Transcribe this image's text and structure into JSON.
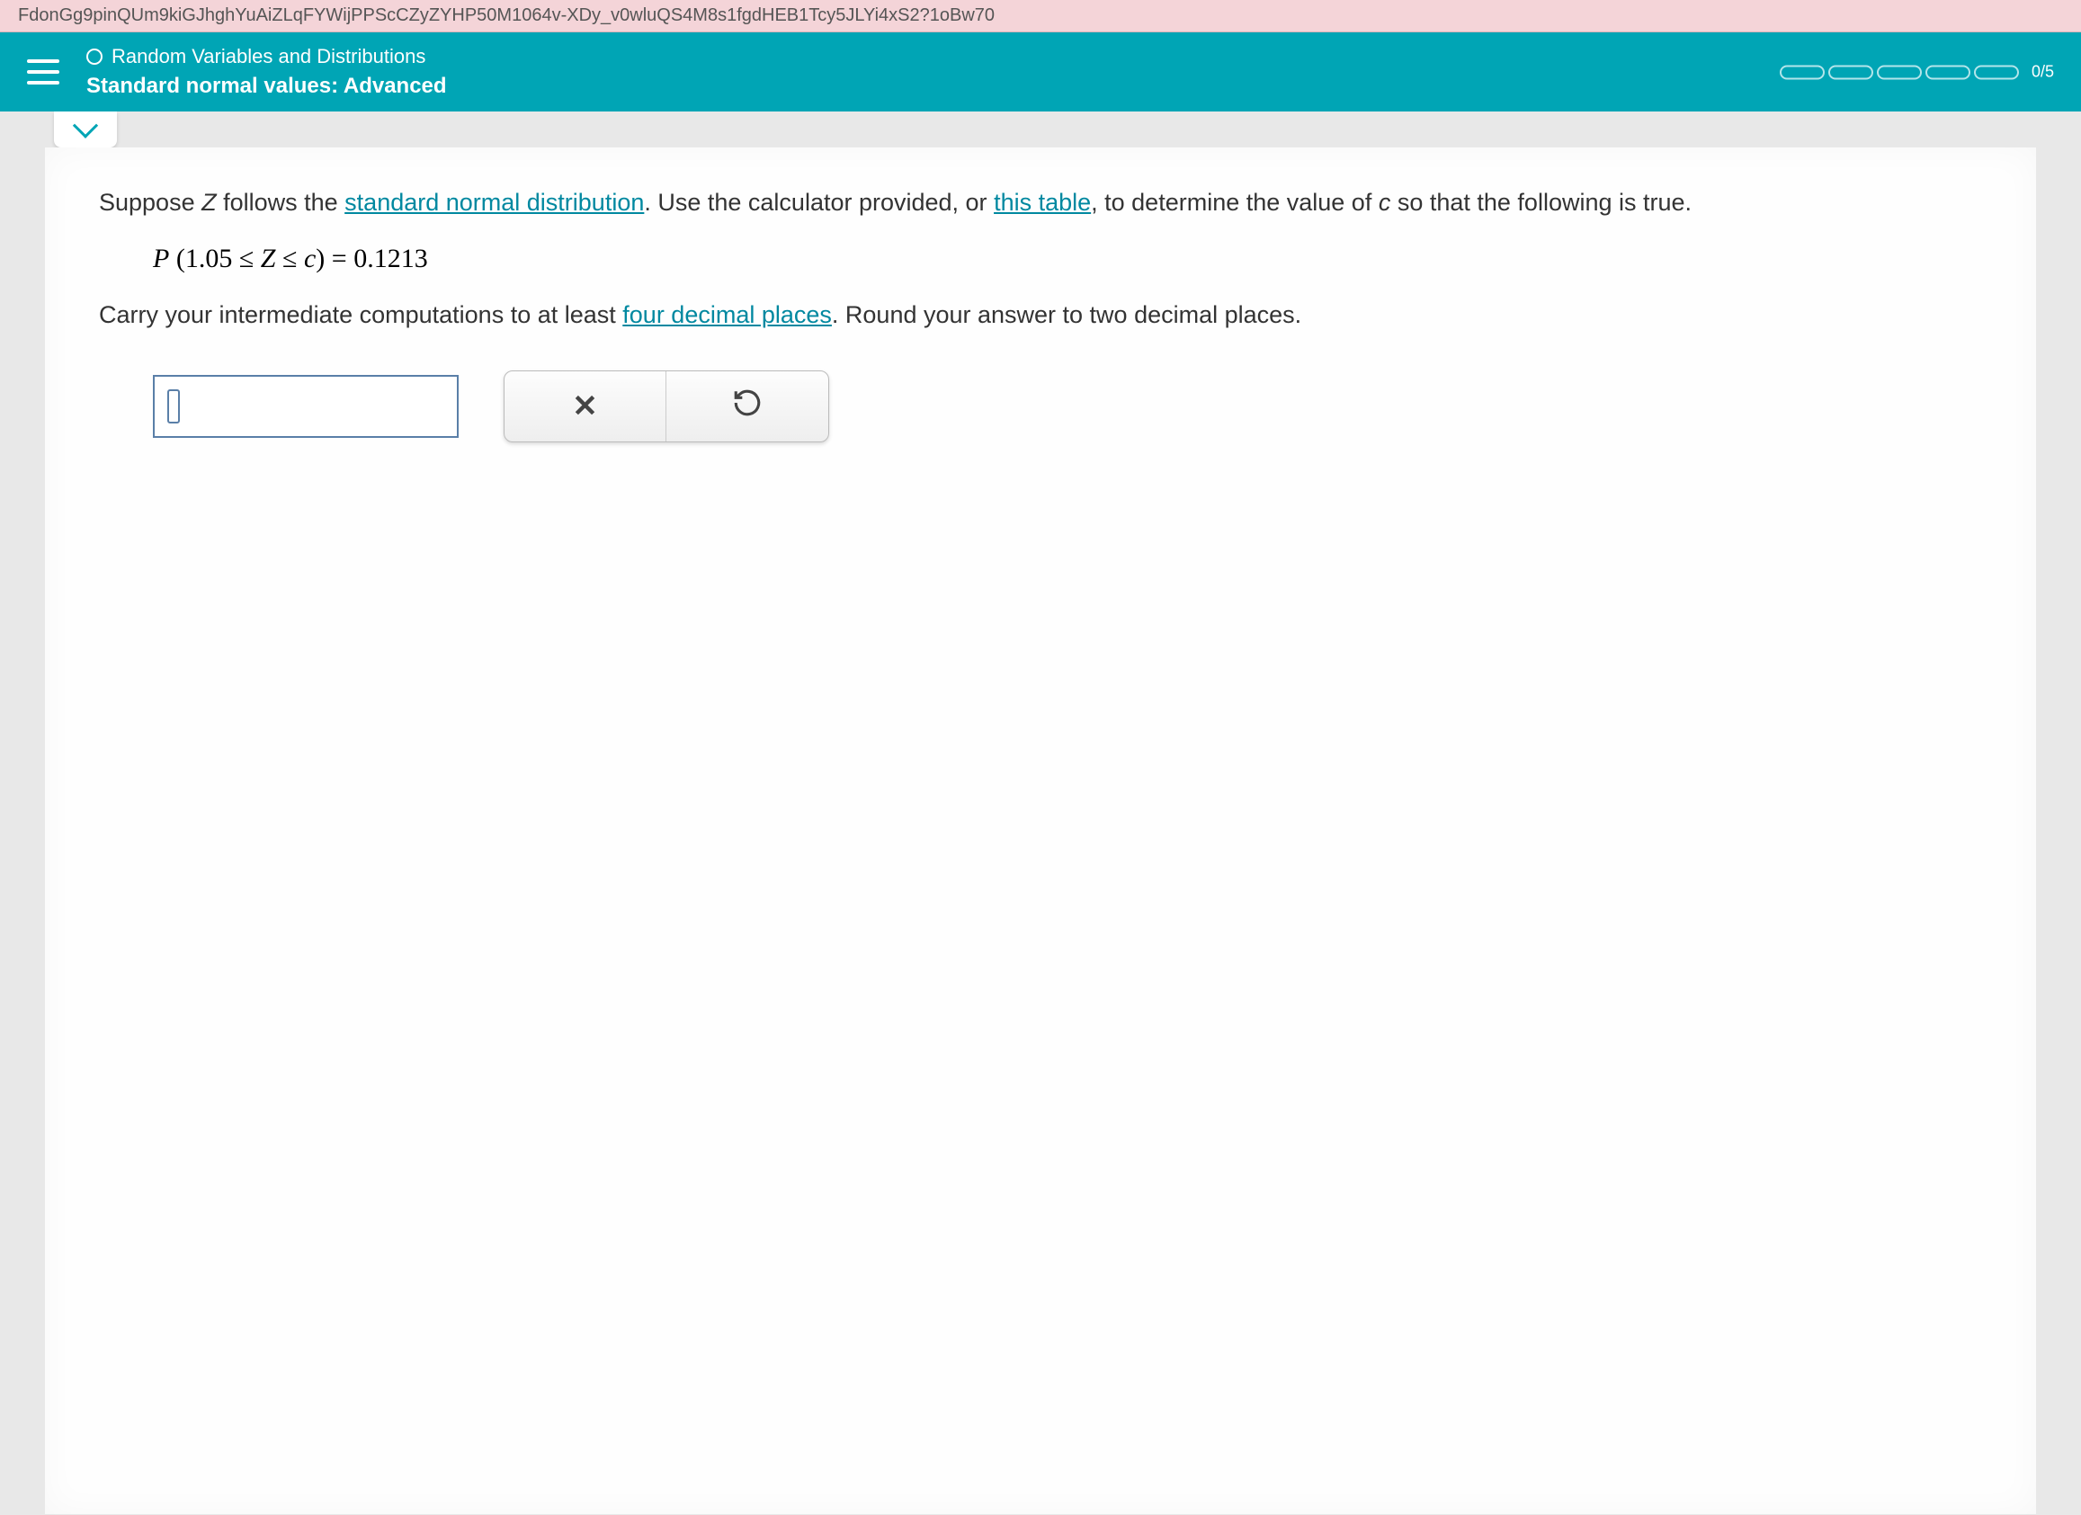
{
  "url_fragment": "FdonGg9pinQUm9kiGJhghYuAiZLqFYWijPPScCZyZYHP50M1064v-XDy_v0wluQS4M8s1fgdHEB1Tcy5JLYi4xS2?1oBw70",
  "header": {
    "breadcrumb": "Random Variables and Distributions",
    "title": "Standard normal values: Advanced",
    "progress": "0/5"
  },
  "problem": {
    "intro_pre": "Suppose ",
    "z_var": "Z",
    "intro_mid": " follows the ",
    "link1": "standard normal distribution",
    "intro_post1": ". Use the calculator provided, or ",
    "link2": "this table",
    "intro_post2": ", to determine the value of ",
    "c_var": "c",
    "intro_end": " so that the following is true.",
    "equation_text": "P (1.05 ≤ Z ≤ c) = 0.1213",
    "instruction_pre": "Carry your intermediate computations to at least ",
    "link3": "four decimal places",
    "instruction_post": ". Round your answer to two decimal places."
  },
  "answer_value": "",
  "buttons": {
    "clear": "×",
    "undo": "↺"
  }
}
